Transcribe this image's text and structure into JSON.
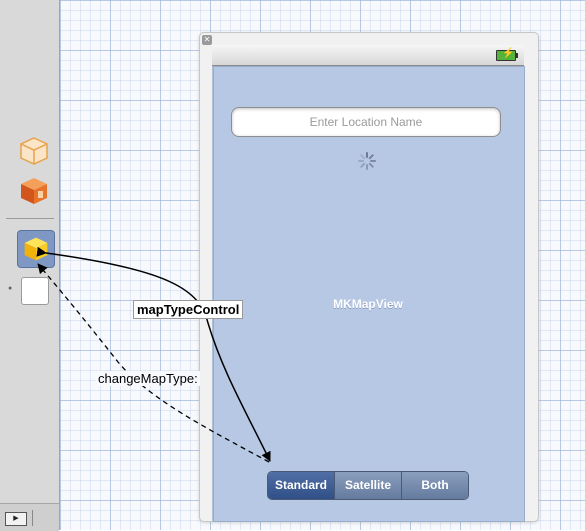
{
  "search": {
    "placeholder": "Enter Location Name"
  },
  "map": {
    "label": "MKMapView"
  },
  "segments": [
    "Standard",
    "Satellite",
    "Both"
  ],
  "selected_segment": "Standard",
  "connections": {
    "outlet": "mapTypeControl",
    "action": "changeMapType:"
  },
  "colors": {
    "map": "#b7c8e5",
    "selected_segment": "#304f86",
    "segment": "#657b9e"
  },
  "icons": {
    "first_responder": "wireframe-cube-icon",
    "files_owner": "orange-cube-icon",
    "controller": "yellow-cube-icon",
    "view": "view-thumbnail-icon",
    "play": "play-icon"
  }
}
